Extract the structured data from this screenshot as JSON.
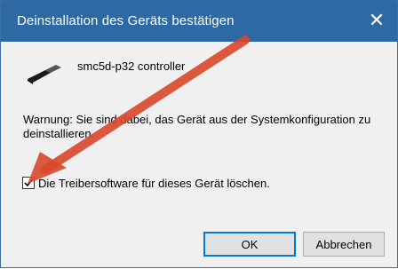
{
  "window": {
    "title": "Deinstallation des Geräts bestätigen",
    "close_symbol": "✕"
  },
  "device": {
    "icon": "usb-plug-icon",
    "name": "smc5d-p32 controller"
  },
  "warning_text": "Warnung: Sie sind dabei, das Gerät aus der Systemkonfiguration zu deinstallieren.",
  "checkbox": {
    "label": "Die Treibersoftware für dieses Gerät löschen.",
    "checked": true
  },
  "buttons": {
    "ok": "OK",
    "cancel": "Abbrechen"
  },
  "annotation": {
    "arrow_color": "#d9472b"
  },
  "colors": {
    "titlebar": "#2d6aa3",
    "dialog_bg": "#f0f0f0"
  }
}
